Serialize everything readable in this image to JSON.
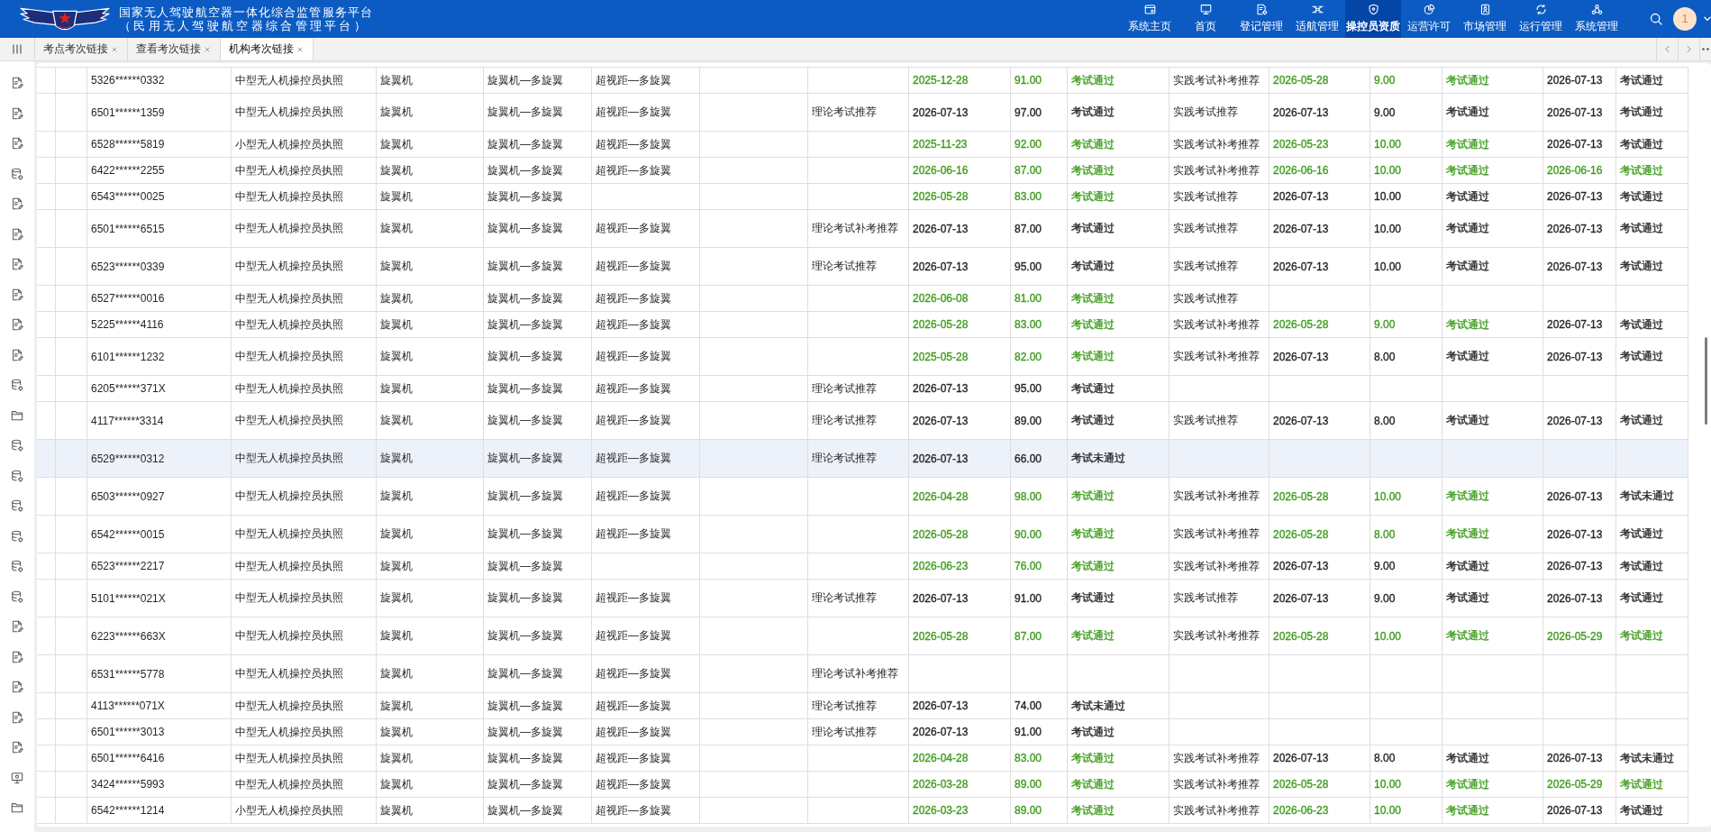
{
  "header": {
    "title": "国家无人驾驶航空器一体化综合监管服务平台",
    "subtitle": "（民用无人驾驶航空器综合管理平台）",
    "nav": [
      {
        "label": "系统主页",
        "selected": false
      },
      {
        "label": "首页",
        "selected": false
      },
      {
        "label": "登记管理",
        "selected": false
      },
      {
        "label": "适航管理",
        "selected": false
      },
      {
        "label": "操控员资质",
        "selected": true
      },
      {
        "label": "运营许可",
        "selected": false
      },
      {
        "label": "市场管理",
        "selected": false
      },
      {
        "label": "运行管理",
        "selected": false
      },
      {
        "label": "系统管理",
        "selected": false
      }
    ],
    "avatar": "1"
  },
  "tabs": [
    {
      "label": "考点考次链接",
      "selected": false
    },
    {
      "label": "查看考次链接",
      "selected": false
    },
    {
      "label": "机构考次链接",
      "selected": true
    }
  ],
  "sidebar": {
    "items": [
      {
        "kind": "document"
      },
      {
        "kind": "document"
      },
      {
        "kind": "document"
      },
      {
        "kind": "database"
      },
      {
        "kind": "document"
      },
      {
        "kind": "document"
      },
      {
        "kind": "document"
      },
      {
        "kind": "document"
      },
      {
        "kind": "document"
      },
      {
        "kind": "document"
      },
      {
        "kind": "database"
      },
      {
        "kind": "folder"
      },
      {
        "kind": "database"
      },
      {
        "kind": "database"
      },
      {
        "kind": "database"
      },
      {
        "kind": "database"
      },
      {
        "kind": "database"
      },
      {
        "kind": "database"
      },
      {
        "kind": "document"
      },
      {
        "kind": "document"
      },
      {
        "kind": "document"
      },
      {
        "kind": "document"
      },
      {
        "kind": "document"
      },
      {
        "kind": "monitor"
      },
      {
        "kind": "folder"
      }
    ]
  },
  "table": {
    "rows": [
      {
        "selected": false,
        "column_3": "5326******0332",
        "column_4": "中型无人机操控员执照",
        "column_5": "旋翼机",
        "column_6": "旋翼机—多旋翼",
        "column_7": "超视距—多旋翼",
        "column_10": {
          "text": "2025-12-28",
          "color": "#3e9c1c"
        },
        "column_11": {
          "text": "91.00",
          "color": "#3e9c1c"
        },
        "column_12": {
          "text": "考试通过",
          "color": "#3e9c1c"
        },
        "column_13": "实践考试补考推荐",
        "column_14": {
          "text": "2026-05-28",
          "color": "#3e9c1c"
        },
        "column_15": {
          "text": "9.00",
          "color": "#3e9c1c"
        },
        "column_16": {
          "text": "考试通过",
          "color": "#3e9c1c"
        },
        "column_17": {
          "text": "2026-07-13",
          "color": "#262626"
        },
        "column_18": {
          "text": "考试通过",
          "color": "#262626"
        }
      },
      {
        "selected": false,
        "column_3": "6501******1359",
        "column_4": "中型无人机操控员执照",
        "column_5": "旋翼机",
        "column_6": "旋翼机—多旋翼",
        "column_7": "超视距—多旋翼",
        "column_9": "理论考试推荐",
        "column_10": {
          "text": "2026-07-13",
          "color": "#262626"
        },
        "column_11": {
          "text": "97.00",
          "color": "#262626"
        },
        "column_12": {
          "text": "考试通过",
          "color": "#262626"
        },
        "column_13": "实践考试推荐",
        "column_14": {
          "text": "2026-07-13",
          "color": "#262626"
        },
        "column_15": {
          "text": "9.00",
          "color": "#262626"
        },
        "column_16": {
          "text": "考试通过",
          "color": "#262626"
        },
        "column_17": {
          "text": "2026-07-13",
          "color": "#262626"
        },
        "column_18": {
          "text": "考试通过",
          "color": "#262626"
        }
      },
      {
        "selected": false,
        "column_3": "6528******5819",
        "column_4": "小型无人机操控员执照",
        "column_5": "旋翼机",
        "column_6": "旋翼机—多旋翼",
        "column_7": "超视距—多旋翼",
        "column_10": {
          "text": "2025-11-23",
          "color": "#3e9c1c"
        },
        "column_11": {
          "text": "92.00",
          "color": "#3e9c1c"
        },
        "column_12": {
          "text": "考试通过",
          "color": "#3e9c1c"
        },
        "column_13": "实践考试补考推荐",
        "column_14": {
          "text": "2026-05-23",
          "color": "#3e9c1c"
        },
        "column_15": {
          "text": "10.00",
          "color": "#3e9c1c"
        },
        "column_16": {
          "text": "考试通过",
          "color": "#3e9c1c"
        },
        "column_17": {
          "text": "2026-07-13",
          "color": "#262626"
        },
        "column_18": {
          "text": "考试通过",
          "color": "#262626"
        }
      },
      {
        "selected": false,
        "column_3": "6422******2255",
        "column_4": "中型无人机操控员执照",
        "column_5": "旋翼机",
        "column_6": "旋翼机—多旋翼",
        "column_7": "超视距—多旋翼",
        "column_10": {
          "text": "2026-06-16",
          "color": "#3e9c1c"
        },
        "column_11": {
          "text": "87.00",
          "color": "#3e9c1c"
        },
        "column_12": {
          "text": "考试通过",
          "color": "#3e9c1c"
        },
        "column_13": "实践考试补考推荐",
        "column_14": {
          "text": "2026-06-16",
          "color": "#3e9c1c"
        },
        "column_15": {
          "text": "10.00",
          "color": "#3e9c1c"
        },
        "column_16": {
          "text": "考试通过",
          "color": "#3e9c1c"
        },
        "column_17": {
          "text": "2026-06-16",
          "color": "#3e9c1c"
        },
        "column_18": {
          "text": "考试通过",
          "color": "#3e9c1c"
        }
      },
      {
        "selected": false,
        "column_3": "6543******0025",
        "column_4": "中型无人机操控员执照",
        "column_5": "旋翼机",
        "column_6": "旋翼机—多旋翼",
        "column_10": {
          "text": "2026-05-28",
          "color": "#3e9c1c"
        },
        "column_11": {
          "text": "83.00",
          "color": "#3e9c1c"
        },
        "column_12": {
          "text": "考试通过",
          "color": "#3e9c1c"
        },
        "column_13": "实践考试推荐",
        "column_14": {
          "text": "2026-07-13",
          "color": "#262626"
        },
        "column_15": {
          "text": "10.00",
          "color": "#262626"
        },
        "column_16": {
          "text": "考试通过",
          "color": "#262626"
        },
        "column_17": {
          "text": "2026-07-13",
          "color": "#262626"
        },
        "column_18": {
          "text": "考试通过",
          "color": "#262626"
        }
      },
      {
        "selected": false,
        "column_3": "6501******6515",
        "column_4": "中型无人机操控员执照",
        "column_5": "旋翼机",
        "column_6": "旋翼机—多旋翼",
        "column_7": "超视距—多旋翼",
        "column_9": "理论考试补考推荐",
        "column_10": {
          "text": "2026-07-13",
          "color": "#262626"
        },
        "column_11": {
          "text": "87.00",
          "color": "#262626"
        },
        "column_12": {
          "text": "考试通过",
          "color": "#262626"
        },
        "column_13": "实践考试推荐",
        "column_14": {
          "text": "2026-07-13",
          "color": "#262626"
        },
        "column_15": {
          "text": "10.00",
          "color": "#262626"
        },
        "column_16": {
          "text": "考试通过",
          "color": "#262626"
        },
        "column_17": {
          "text": "2026-07-13",
          "color": "#262626"
        },
        "column_18": {
          "text": "考试通过",
          "color": "#262626"
        }
      },
      {
        "selected": false,
        "column_3": "6523******0339",
        "column_4": "中型无人机操控员执照",
        "column_5": "旋翼机",
        "column_6": "旋翼机—多旋翼",
        "column_7": "超视距—多旋翼",
        "column_9": "理论考试推荐",
        "column_10": {
          "text": "2026-07-13",
          "color": "#262626"
        },
        "column_11": {
          "text": "95.00",
          "color": "#262626"
        },
        "column_12": {
          "text": "考试通过",
          "color": "#262626"
        },
        "column_13": "实践考试推荐",
        "column_14": {
          "text": "2026-07-13",
          "color": "#262626"
        },
        "column_15": {
          "text": "10.00",
          "color": "#262626"
        },
        "column_16": {
          "text": "考试通过",
          "color": "#262626"
        },
        "column_17": {
          "text": "2026-07-13",
          "color": "#262626"
        },
        "column_18": {
          "text": "考试通过",
          "color": "#262626"
        }
      },
      {
        "selected": false,
        "column_3": "6527******0016",
        "column_4": "中型无人机操控员执照",
        "column_5": "旋翼机",
        "column_6": "旋翼机—多旋翼",
        "column_7": "超视距—多旋翼",
        "column_10": {
          "text": "2026-06-08",
          "color": "#3e9c1c"
        },
        "column_11": {
          "text": "81.00",
          "color": "#3e9c1c"
        },
        "column_12": {
          "text": "考试通过",
          "color": "#3e9c1c"
        },
        "column_13": "实践考试推荐"
      },
      {
        "selected": false,
        "column_3": "5225******4116",
        "column_4": "中型无人机操控员执照",
        "column_5": "旋翼机",
        "column_6": "旋翼机—多旋翼",
        "column_7": "超视距—多旋翼",
        "column_10": {
          "text": "2026-05-28",
          "color": "#3e9c1c"
        },
        "column_11": {
          "text": "83.00",
          "color": "#3e9c1c"
        },
        "column_12": {
          "text": "考试通过",
          "color": "#3e9c1c"
        },
        "column_13": "实践考试补考推荐",
        "column_14": {
          "text": "2026-05-28",
          "color": "#3e9c1c"
        },
        "column_15": {
          "text": "9.00",
          "color": "#3e9c1c"
        },
        "column_16": {
          "text": "考试通过",
          "color": "#3e9c1c"
        },
        "column_17": {
          "text": "2026-07-13",
          "color": "#262626"
        },
        "column_18": {
          "text": "考试通过",
          "color": "#262626"
        }
      },
      {
        "selected": false,
        "column_3": "6101******1232",
        "column_4": "中型无人机操控员执照",
        "column_5": "旋翼机",
        "column_6": "旋翼机—多旋翼",
        "column_7": "超视距—多旋翼",
        "column_10": {
          "text": "2025-05-28",
          "color": "#3e9c1c"
        },
        "column_11": {
          "text": "82.00",
          "color": "#3e9c1c"
        },
        "column_12": {
          "text": "考试通过",
          "color": "#3e9c1c"
        },
        "column_13": "实践考试补考推荐",
        "column_14": {
          "text": "2026-07-13",
          "color": "#262626"
        },
        "column_15": {
          "text": "8.00",
          "color": "#262626"
        },
        "column_16": {
          "text": "考试通过",
          "color": "#262626"
        },
        "column_17": {
          "text": "2026-07-13",
          "color": "#262626"
        },
        "column_18": {
          "text": "考试通过",
          "color": "#262626"
        }
      },
      {
        "selected": false,
        "column_3": "6205******371X",
        "column_4": "中型无人机操控员执照",
        "column_5": "旋翼机",
        "column_6": "旋翼机—多旋翼",
        "column_7": "超视距—多旋翼",
        "column_9": "理论考试推荐",
        "column_10": {
          "text": "2026-07-13",
          "color": "#262626"
        },
        "column_11": {
          "text": "95.00",
          "color": "#262626"
        },
        "column_12": {
          "text": "考试通过",
          "color": "#262626"
        }
      },
      {
        "selected": false,
        "column_3": "4117******3314",
        "column_4": "中型无人机操控员执照",
        "column_5": "旋翼机",
        "column_6": "旋翼机—多旋翼",
        "column_7": "超视距—多旋翼",
        "column_9": "理论考试推荐",
        "column_10": {
          "text": "2026-07-13",
          "color": "#262626"
        },
        "column_11": {
          "text": "89.00",
          "color": "#262626"
        },
        "column_12": {
          "text": "考试通过",
          "color": "#262626"
        },
        "column_13": "实践考试推荐",
        "column_14": {
          "text": "2026-07-13",
          "color": "#262626"
        },
        "column_15": {
          "text": "8.00",
          "color": "#262626"
        },
        "column_16": {
          "text": "考试通过",
          "color": "#262626"
        },
        "column_17": {
          "text": "2026-07-13",
          "color": "#262626"
        },
        "column_18": {
          "text": "考试通过",
          "color": "#262626"
        }
      },
      {
        "selected": true,
        "column_3": "6529******0312",
        "column_4": "中型无人机操控员执照",
        "column_5": "旋翼机",
        "column_6": "旋翼机—多旋翼",
        "column_7": "超视距—多旋翼",
        "column_9": "理论考试推荐",
        "column_10": {
          "text": "2026-07-13",
          "color": "#262626"
        },
        "column_11": {
          "text": "66.00",
          "color": "#262626"
        },
        "column_12": {
          "text": "考试未通过",
          "color": "#262626"
        }
      },
      {
        "selected": false,
        "column_3": "6503******0927",
        "column_4": "中型无人机操控员执照",
        "column_5": "旋翼机",
        "column_6": "旋翼机—多旋翼",
        "column_7": "超视距—多旋翼",
        "column_10": {
          "text": "2026-04-28",
          "color": "#3e9c1c"
        },
        "column_11": {
          "text": "98.00",
          "color": "#3e9c1c"
        },
        "column_12": {
          "text": "考试通过",
          "color": "#3e9c1c"
        },
        "column_13": "实践考试补考推荐",
        "column_14": {
          "text": "2026-05-28",
          "color": "#3e9c1c"
        },
        "column_15": {
          "text": "10.00",
          "color": "#3e9c1c"
        },
        "column_16": {
          "text": "考试通过",
          "color": "#3e9c1c"
        },
        "column_17": {
          "text": "2026-07-13",
          "color": "#262626"
        },
        "column_18": {
          "text": "考试未通过",
          "color": "#262626"
        }
      },
      {
        "selected": false,
        "column_3": "6542******0015",
        "column_4": "中型无人机操控员执照",
        "column_5": "旋翼机",
        "column_6": "旋翼机—多旋翼",
        "column_7": "超视距—多旋翼",
        "column_10": {
          "text": "2026-05-28",
          "color": "#3e9c1c"
        },
        "column_11": {
          "text": "90.00",
          "color": "#3e9c1c"
        },
        "column_12": {
          "text": "考试通过",
          "color": "#3e9c1c"
        },
        "column_13": "实践考试补考推荐",
        "column_14": {
          "text": "2026-05-28",
          "color": "#3e9c1c"
        },
        "column_15": {
          "text": "8.00",
          "color": "#3e9c1c"
        },
        "column_16": {
          "text": "考试通过",
          "color": "#3e9c1c"
        },
        "column_17": {
          "text": "2026-07-13",
          "color": "#262626"
        },
        "column_18": {
          "text": "考试通过",
          "color": "#262626"
        }
      },
      {
        "selected": false,
        "column_3": "6523******2217",
        "column_4": "中型无人机操控员执照",
        "column_5": "旋翼机",
        "column_6": "旋翼机—多旋翼",
        "column_10": {
          "text": "2026-06-23",
          "color": "#3e9c1c"
        },
        "column_11": {
          "text": "76.00",
          "color": "#3e9c1c"
        },
        "column_12": {
          "text": "考试通过",
          "color": "#3e9c1c"
        },
        "column_13": "实践考试补考推荐",
        "column_14": {
          "text": "2026-07-13",
          "color": "#262626"
        },
        "column_15": {
          "text": "9.00",
          "color": "#262626"
        },
        "column_16": {
          "text": "考试通过",
          "color": "#262626"
        },
        "column_17": {
          "text": "2026-07-13",
          "color": "#262626"
        },
        "column_18": {
          "text": "考试通过",
          "color": "#262626"
        }
      },
      {
        "selected": false,
        "column_3": "5101******021X",
        "column_4": "中型无人机操控员执照",
        "column_5": "旋翼机",
        "column_6": "旋翼机—多旋翼",
        "column_7": "超视距—多旋翼",
        "column_9": "理论考试推荐",
        "column_10": {
          "text": "2026-07-13",
          "color": "#262626"
        },
        "column_11": {
          "text": "91.00",
          "color": "#262626"
        },
        "column_12": {
          "text": "考试通过",
          "color": "#262626"
        },
        "column_13": "实践考试推荐",
        "column_14": {
          "text": "2026-07-13",
          "color": "#262626"
        },
        "column_15": {
          "text": "9.00",
          "color": "#262626"
        },
        "column_16": {
          "text": "考试通过",
          "color": "#262626"
        },
        "column_17": {
          "text": "2026-07-13",
          "color": "#262626"
        },
        "column_18": {
          "text": "考试通过",
          "color": "#262626"
        }
      },
      {
        "selected": false,
        "column_3": "6223******663X",
        "column_4": "中型无人机操控员执照",
        "column_5": "旋翼机",
        "column_6": "旋翼机—多旋翼",
        "column_7": "超视距—多旋翼",
        "column_10": {
          "text": "2026-05-28",
          "color": "#3e9c1c"
        },
        "column_11": {
          "text": "87.00",
          "color": "#3e9c1c"
        },
        "column_12": {
          "text": "考试通过",
          "color": "#3e9c1c"
        },
        "column_13": "实践考试补考推荐",
        "column_14": {
          "text": "2026-05-28",
          "color": "#3e9c1c"
        },
        "column_15": {
          "text": "10.00",
          "color": "#3e9c1c"
        },
        "column_16": {
          "text": "考试通过",
          "color": "#3e9c1c"
        },
        "column_17": {
          "text": "2026-05-29",
          "color": "#3e9c1c"
        },
        "column_18": {
          "text": "考试通过",
          "color": "#3e9c1c"
        }
      },
      {
        "selected": false,
        "column_3": "6531******5778",
        "column_4": "中型无人机操控员执照",
        "column_5": "旋翼机",
        "column_6": "旋翼机—多旋翼",
        "column_7": "超视距—多旋翼",
        "column_9": "理论考试补考推荐"
      },
      {
        "selected": false,
        "column_3": "4113******071X",
        "column_4": "中型无人机操控员执照",
        "column_5": "旋翼机",
        "column_6": "旋翼机—多旋翼",
        "column_7": "超视距—多旋翼",
        "column_9": "理论考试推荐",
        "column_10": {
          "text": "2026-07-13",
          "color": "#262626"
        },
        "column_11": {
          "text": "74.00",
          "color": "#262626"
        },
        "column_12": {
          "text": "考试未通过",
          "color": "#262626"
        }
      },
      {
        "selected": false,
        "column_3": "6501******3013",
        "column_4": "中型无人机操控员执照",
        "column_5": "旋翼机",
        "column_6": "旋翼机—多旋翼",
        "column_7": "超视距—多旋翼",
        "column_9": "理论考试推荐",
        "column_10": {
          "text": "2026-07-13",
          "color": "#262626"
        },
        "column_11": {
          "text": "91.00",
          "color": "#262626"
        },
        "column_12": {
          "text": "考试通过",
          "color": "#262626"
        }
      },
      {
        "selected": false,
        "column_3": "6501******6416",
        "column_4": "中型无人机操控员执照",
        "column_5": "旋翼机",
        "column_6": "旋翼机—多旋翼",
        "column_7": "超视距—多旋翼",
        "column_10": {
          "text": "2026-04-28",
          "color": "#3e9c1c"
        },
        "column_11": {
          "text": "83.00",
          "color": "#3e9c1c"
        },
        "column_12": {
          "text": "考试通过",
          "color": "#3e9c1c"
        },
        "column_13": "实践考试补考推荐",
        "column_14": {
          "text": "2026-07-13",
          "color": "#262626"
        },
        "column_15": {
          "text": "8.00",
          "color": "#262626"
        },
        "column_16": {
          "text": "考试通过",
          "color": "#262626"
        },
        "column_17": {
          "text": "2026-07-13",
          "color": "#262626"
        },
        "column_18": {
          "text": "考试未通过",
          "color": "#262626"
        }
      },
      {
        "selected": false,
        "column_3": "3424******5993",
        "column_4": "中型无人机操控员执照",
        "column_5": "旋翼机",
        "column_6": "旋翼机—多旋翼",
        "column_7": "超视距—多旋翼",
        "column_10": {
          "text": "2026-03-28",
          "color": "#3e9c1c"
        },
        "column_11": {
          "text": "89.00",
          "color": "#3e9c1c"
        },
        "column_12": {
          "text": "考试通过",
          "color": "#3e9c1c"
        },
        "column_13": "实践考试补考推荐",
        "column_14": {
          "text": "2026-05-28",
          "color": "#3e9c1c"
        },
        "column_15": {
          "text": "10.00",
          "color": "#3e9c1c"
        },
        "column_16": {
          "text": "考试通过",
          "color": "#3e9c1c"
        },
        "column_17": {
          "text": "2026-05-29",
          "color": "#3e9c1c"
        },
        "column_18": {
          "text": "考试通过",
          "color": "#3e9c1c"
        }
      },
      {
        "selected": false,
        "column_3": "6542******1214",
        "column_4": "小型无人机操控员执照",
        "column_5": "旋翼机",
        "column_6": "旋翼机—多旋翼",
        "column_7": "超视距—多旋翼",
        "column_10": {
          "text": "2026-03-23",
          "color": "#3e9c1c"
        },
        "column_11": {
          "text": "89.00",
          "color": "#3e9c1c"
        },
        "column_12": {
          "text": "考试通过",
          "color": "#3e9c1c"
        },
        "column_13": "实践考试补考推荐",
        "column_14": {
          "text": "2026-06-23",
          "color": "#3e9c1c"
        },
        "column_15": {
          "text": "10.00",
          "color": "#3e9c1c"
        },
        "column_16": {
          "text": "考试通过",
          "color": "#3e9c1c"
        },
        "column_17": {
          "text": "2026-07-13",
          "color": "#262626"
        },
        "column_18": {
          "text": "考试通过",
          "color": "#262626"
        }
      }
    ]
  }
}
